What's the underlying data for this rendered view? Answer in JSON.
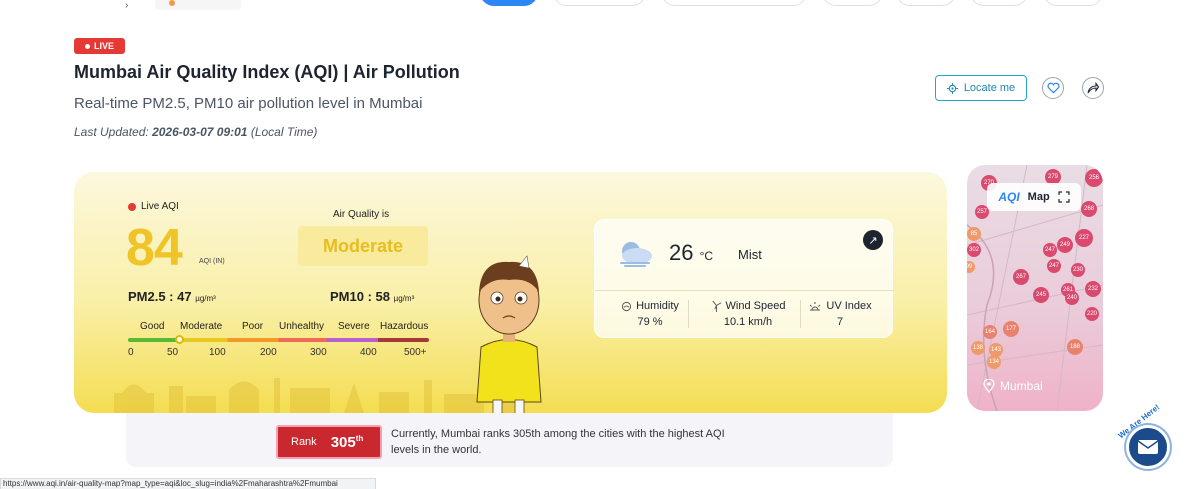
{
  "header": {
    "live_badge": "LIVE",
    "title": "Mumbai Air Quality Index (AQI) | Air Pollution",
    "subtitle": "Real-time PM2.5, PM10 air pollution level in Mumbai",
    "last_updated_prefix": "Last Updated:",
    "last_updated_value": "2026-03-07 09:01",
    "last_updated_suffix": "(Local Time)",
    "locate_label": "Locate me"
  },
  "aqi": {
    "live_label": "Live AQI",
    "value": "84",
    "unit": "AQI (IN)",
    "air_quality_is": "Air Quality is",
    "status": "Moderate",
    "status_color": "#e9bd1e",
    "pm25_label": "PM2.5 :",
    "pm25_value": "47",
    "pm10_label": "PM10 :",
    "pm10_value": "58",
    "pm_unit": "µg/m³",
    "marker_fraction": 0.168,
    "scale_labels": [
      "Good",
      "Moderate",
      "Poor",
      "Unhealthy",
      "Severe",
      "Hazardous"
    ],
    "scale_numbers": [
      "0",
      "50",
      "100",
      "200",
      "300",
      "400",
      "500+"
    ]
  },
  "weather": {
    "temperature": "26",
    "temp_unit": "°C",
    "condition": "Mist",
    "humidity_label": "Humidity",
    "humidity_value": "79 %",
    "wind_label": "Wind Speed",
    "wind_value": "10.1 km/h",
    "uv_label": "UV Index",
    "uv_value": "7"
  },
  "rank": {
    "label": "Rank",
    "value": "305",
    "suffix": "th",
    "description": "Currently, Mumbai ranks 305th among the cities with the highest AQI levels in the world."
  },
  "map": {
    "logo": "AQI",
    "label": "Map",
    "location": "Mumbai",
    "markers": [
      "279",
      "256",
      "270",
      "257",
      "268",
      "302",
      "227",
      "249",
      "247",
      "247",
      "230",
      "267",
      "245",
      "261",
      "232",
      "240",
      "220",
      "177",
      "164",
      "188",
      "138",
      "143",
      "134",
      "85",
      "99"
    ]
  },
  "status_bar": {
    "url": "https://www.aqi.in/air-quality-map?map_type=aqi&loc_slug=india%2Fmaharashtra%2Fmumbai"
  },
  "widget": {
    "help_label": "We Are Here!"
  }
}
